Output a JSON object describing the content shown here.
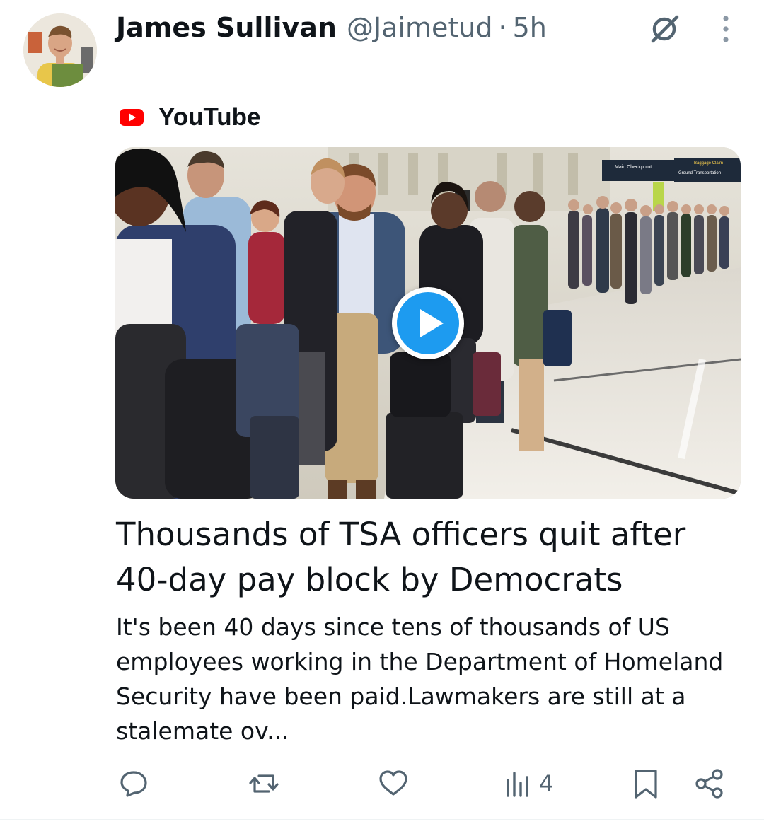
{
  "post": {
    "author": {
      "display_name": "James Sullivan",
      "handle": "@Jaimetud",
      "separator": "·",
      "time": "5h"
    },
    "icons": {
      "grok": "grok-icon",
      "more": "more-vertical-icon"
    },
    "card": {
      "source_icon": "youtube-icon",
      "source_name": "YouTube",
      "headline": "Thousands of TSA officers quit after 40-day pay block by Democrats",
      "description": "It's been 40 days since tens of thousands of US employees working in the Department of Homeland Security have been paid.Lawmakers are still at a stalemate ov...",
      "video_play_icon": "play-icon",
      "thumbnail_signs": {
        "main": "Main Checkpoint",
        "baggage": "Baggage Claim",
        "ground": "Ground Transportation"
      }
    },
    "actions": {
      "reply": {
        "icon": "reply-icon",
        "count": ""
      },
      "repost": {
        "icon": "repost-icon",
        "count": ""
      },
      "like": {
        "icon": "heart-icon",
        "count": ""
      },
      "views": {
        "icon": "views-icon",
        "count": "4"
      },
      "bookmark": {
        "icon": "bookmark-icon"
      },
      "share": {
        "icon": "share-icon"
      }
    }
  },
  "colors": {
    "text_primary": "#0f1419",
    "text_secondary": "#536471",
    "accent": "#1d9bf0",
    "youtube_red": "#ff0000"
  }
}
